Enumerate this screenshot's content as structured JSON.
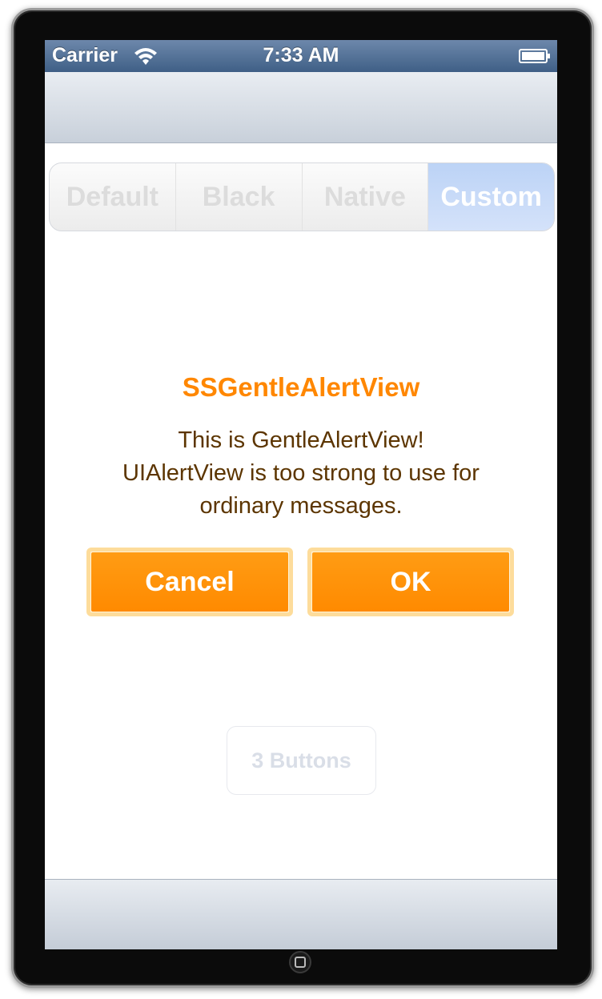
{
  "status_bar": {
    "carrier": "Carrier",
    "time": "7:33 AM",
    "wifi_icon": "wifi-icon",
    "battery_icon": "battery-icon"
  },
  "segmented_control": {
    "segments": [
      {
        "label": "Default",
        "selected": false
      },
      {
        "label": "Black",
        "selected": false
      },
      {
        "label": "Native",
        "selected": false
      },
      {
        "label": "Custom",
        "selected": true
      }
    ]
  },
  "alert": {
    "title": "SSGentleAlertView",
    "message_lines": [
      "This is GentleAlertView!",
      "UIAlertView is too strong to use for",
      "ordinary messages."
    ],
    "cancel_label": "Cancel",
    "ok_label": "OK"
  },
  "main": {
    "three_buttons_label": "3 Buttons"
  },
  "colors": {
    "status_bar": "#4a6890",
    "alert_title": "#ff8700",
    "alert_message": "#5c3500",
    "alert_button": "#ff9000",
    "alert_button_border": "#fddc9b",
    "selected_segment": "#c2d7f8"
  }
}
